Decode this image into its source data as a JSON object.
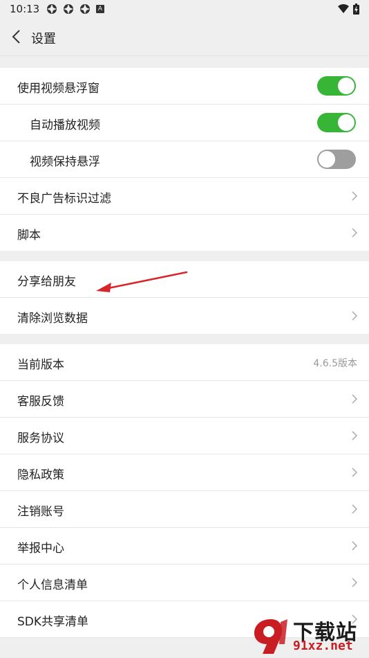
{
  "status_bar": {
    "time": "10:13",
    "notif_letter": "A"
  },
  "app_bar": {
    "title": "设置"
  },
  "section1": [
    {
      "label": "使用视频悬浮窗",
      "control": "toggle",
      "on": true
    },
    {
      "label": "自动播放视频",
      "control": "toggle",
      "on": true
    },
    {
      "label": "视频保持悬浮",
      "control": "toggle",
      "on": false
    },
    {
      "label": "不良广告标识过滤",
      "control": "chevron"
    },
    {
      "label": "脚本",
      "control": "chevron"
    }
  ],
  "section2": [
    {
      "label": "分享给朋友"
    },
    {
      "label": "清除浏览数据",
      "control": "chevron"
    }
  ],
  "section3": [
    {
      "label": "当前版本",
      "value": "4.6.5版本"
    },
    {
      "label": "客服反馈",
      "control": "chevron"
    },
    {
      "label": "服务协议",
      "control": "chevron"
    },
    {
      "label": "隐私政策",
      "control": "chevron"
    },
    {
      "label": "注销账号",
      "control": "chevron"
    },
    {
      "label": "举报中心",
      "control": "chevron"
    },
    {
      "label": "个人信息清单",
      "control": "chevron"
    },
    {
      "label": "SDK共享清单",
      "control": "chevron"
    }
  ],
  "watermark": {
    "cn": "下载站",
    "url": "91xz.net"
  },
  "colors": {
    "toggle_on": "#36b537",
    "toggle_off": "#9e9e9e",
    "arrow": "#d6262b"
  }
}
